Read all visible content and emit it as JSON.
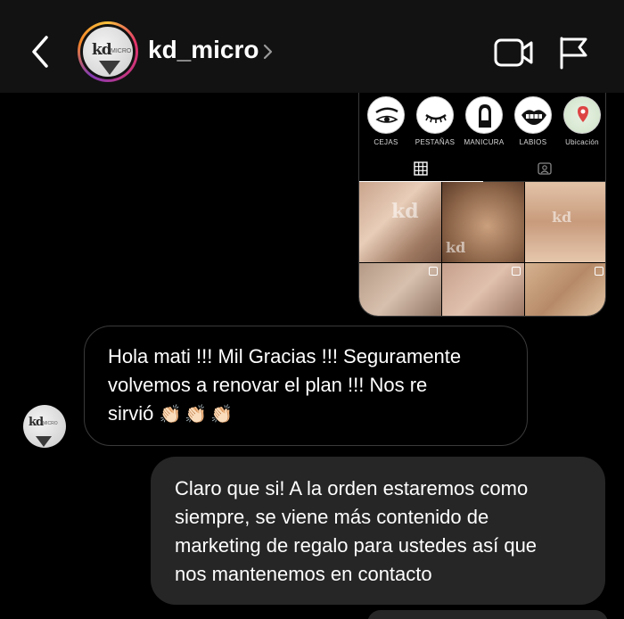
{
  "header": {
    "username": "kd_micro",
    "icons": [
      "back-chevron-icon",
      "video-call-icon",
      "report-flag-icon"
    ]
  },
  "shared_post": {
    "highlights": [
      {
        "label": "CEJAS"
      },
      {
        "label": "PESTAÑAS"
      },
      {
        "label": "MANICURA"
      },
      {
        "label": "LABIOS"
      },
      {
        "label": "Ubicación"
      }
    ]
  },
  "messages": [
    {
      "direction": "incoming",
      "lines": [
        "Hola mati !!! Mil Gracias !!! Seguramente",
        "volvemos a renovar el plan !!! Nos re",
        "sirvió"
      ],
      "emoji": [
        "👏🏻",
        "👏🏻",
        "👏🏻"
      ]
    },
    {
      "direction": "outgoing",
      "lines": [
        "Claro que si! A la orden estaremos como",
        "siempre, se viene más contenido de",
        "marketing de regalo para ustedes así que",
        "nos mantenemos en contacto"
      ]
    }
  ],
  "colors": {
    "header_bg": "#121212",
    "outgoing_bubble": "#262626",
    "incoming_border": "#3a3a3a"
  }
}
